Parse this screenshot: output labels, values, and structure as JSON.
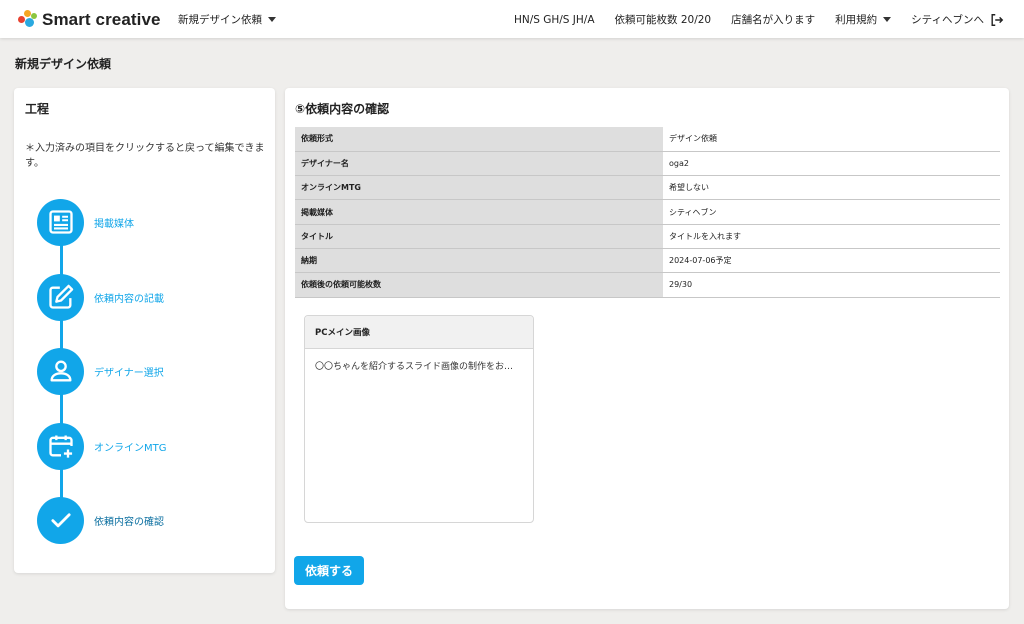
{
  "header": {
    "logo_text": "Smart creative",
    "nav_left": "新規デザイン依頼",
    "codes": "HN/S GH/S JH/A",
    "quota_label": "依頼可能枚数 20/20",
    "store": "店舗名が入ります",
    "terms": "利用規約",
    "city": "シティヘブンへ"
  },
  "page": {
    "title": "新規デザイン依頼"
  },
  "process": {
    "title": "工程",
    "note": "＊入力済みの項目をクリックすると戻って編集できます。",
    "steps": [
      {
        "label": "掲載媒体",
        "icon": "newspaper-icon"
      },
      {
        "label": "依頼内容の記載",
        "icon": "edit-icon"
      },
      {
        "label": "デザイナー選択",
        "icon": "user-icon"
      },
      {
        "label": "オンラインMTG",
        "icon": "calendar-plus-icon"
      },
      {
        "label": "依頼内容の確認",
        "icon": "check-icon"
      }
    ]
  },
  "confirm": {
    "title": "⑤依頼内容の確認",
    "rows": [
      {
        "key": "依頼形式",
        "value": "デザイン依頼"
      },
      {
        "key": "デザイナー名",
        "value": "oga2"
      },
      {
        "key": "オンラインMTG",
        "value": "希望しない"
      },
      {
        "key": "掲載媒体",
        "value": "シティヘブン"
      },
      {
        "key": "タイトル",
        "value": "タイトルを入れます"
      },
      {
        "key": "納期",
        "value": "2024-07-06予定"
      },
      {
        "key": "依頼後の依頼可能枚数",
        "value": "29/30"
      }
    ],
    "image_card": {
      "title": "PCメイン画像",
      "body": "〇〇ちゃんを紹介するスライド画像の制作をお…"
    },
    "submit_label": "依頼する"
  },
  "colors": {
    "accent": "#11a6e9",
    "background": "#efeeec"
  }
}
